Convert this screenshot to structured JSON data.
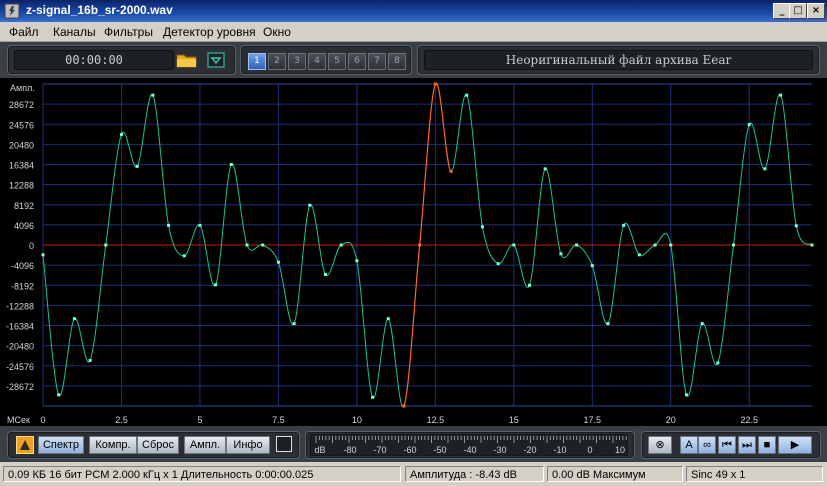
{
  "window": {
    "title": "z-signal_16b_sr-2000.wav",
    "minimize": "_",
    "maximize": "□",
    "close": "×"
  },
  "menu": [
    "Файл",
    "Каналы",
    "Фильтры",
    "Детектор уровня",
    "Окно"
  ],
  "toolbar": {
    "time": "00:00:00",
    "channels": [
      "1",
      "2",
      "3",
      "4",
      "5",
      "6",
      "7",
      "8"
    ],
    "active_channel": "1",
    "message": "Неоригинальный файл архива Eear"
  },
  "chart_data": {
    "type": "line",
    "ylabel": "Ампл.",
    "xlabel": "МСек",
    "y_ticks": [
      "28672",
      "24576",
      "20480",
      "16384",
      "12288",
      "8192",
      "4096",
      "0",
      "-4096",
      "-8192",
      "-12288",
      "-16384",
      "-20480",
      "-24576",
      "-28672"
    ],
    "x_ticks": [
      "0",
      "2.5",
      "5",
      "7.5",
      "10",
      "12.5",
      "15",
      "17.5",
      "20",
      "22.5"
    ],
    "xlim": [
      0,
      24.5
    ],
    "ylim": [
      -32768,
      32768
    ],
    "colors": {
      "signal": "#19c48a",
      "segment": "#ff6a1a",
      "zero_line": "#c21a1a",
      "grid": "#1e2f78",
      "clip": "#2a4aa0"
    },
    "series": [
      {
        "x": [
          0,
          0.5,
          1.0,
          1.5,
          2.0,
          2.5,
          3.0,
          3.5,
          4.0,
          4.5,
          5.0,
          5.5,
          6.0,
          6.5,
          7.0,
          7.5,
          8.0,
          8.5,
          9.0,
          9.5,
          10.0,
          10.5,
          11.0,
          11.5,
          12.0,
          12.5,
          13.0,
          13.5,
          14.0,
          14.5,
          15.0,
          15.5,
          16.0,
          16.5,
          17.0,
          17.5,
          18.0,
          18.5,
          19.0,
          19.5,
          20.0,
          20.5,
          21.0,
          21.5,
          22.0,
          22.5,
          23.0,
          23.5,
          24.0,
          24.5
        ],
        "values": [
          -2000,
          -30500,
          -15000,
          -23500,
          0,
          22500,
          16000,
          30500,
          4000,
          -2200,
          4000,
          -8100,
          16400,
          0,
          0,
          -3500,
          -16000,
          8100,
          -6000,
          0,
          -3200,
          -31000,
          -15000,
          -32768,
          0,
          32768,
          15000,
          30500,
          3700,
          -3800,
          0,
          -8200,
          15500,
          -1800,
          0,
          -4200,
          -16000,
          4000,
          -2000,
          0,
          0,
          -30500,
          -16000,
          -24000,
          0,
          24500,
          15500,
          30500,
          3900,
          0
        ]
      }
    ],
    "highlight_range": [
      11.5,
      13.0
    ]
  },
  "transport": {
    "buttons": [
      "Спектр",
      "Компр.",
      "Сброс",
      "Ампл.",
      "Инфо"
    ],
    "meter_ticks": [
      "dB",
      "-80",
      "-70",
      "-60",
      "-50",
      "-40",
      "-30",
      "-20",
      "-10",
      "0",
      "10"
    ],
    "playback": [
      "⊗",
      "A",
      "∞",
      "⏮",
      "⏭",
      "■",
      "▶"
    ]
  },
  "status": {
    "file_info": "0.09 КБ 16 бит PCM 2.000 кГц x 1  Длительность 0:00:00.025",
    "amplitude": "Амплитуда : -8.43 dB",
    "max": "0.00 dB Максимум",
    "sinc": "Sinc 49 x 1"
  }
}
